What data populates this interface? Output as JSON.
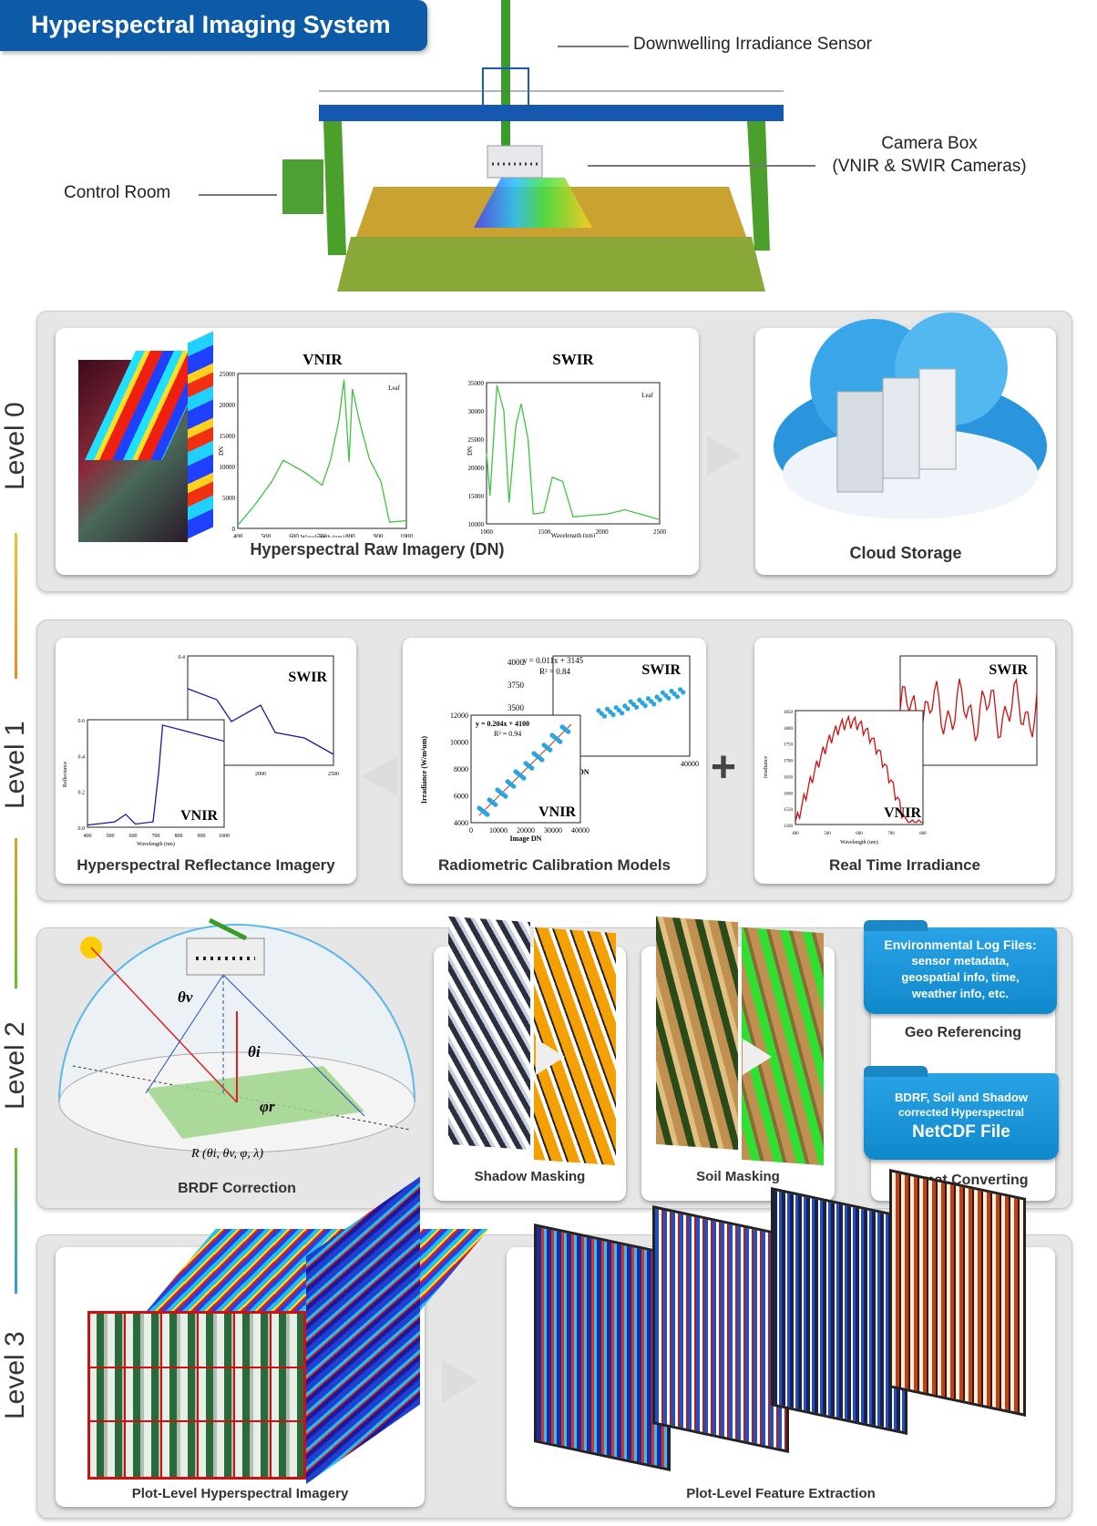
{
  "header": {
    "title": "Hyperspectral Imaging System"
  },
  "system": {
    "sensor_label": "Downwelling Irradiance Sensor",
    "camera_label_1": "Camera Box",
    "camera_label_2": "(VNIR & SWIR Cameras)",
    "control_label": "Control Room"
  },
  "levels": [
    "Level 0",
    "Level 1",
    "Level 2",
    "Level 3"
  ],
  "level0": {
    "raw_caption": "Hyperspectral Raw Imagery (DN)",
    "cloud_caption": "Cloud Storage",
    "vnir": {
      "title": "VNIR",
      "legend": "Leaf",
      "ylabel": "DN",
      "xlabel": "Wavelength (nm)",
      "xticks": [
        "400",
        "500",
        "600",
        "700",
        "800",
        "900",
        "1000"
      ],
      "yticks": [
        "0",
        "5000",
        "10000",
        "15000",
        "20000",
        "25000"
      ]
    },
    "swir": {
      "title": "SWIR",
      "legend": "Leaf",
      "ylabel": "DN",
      "xlabel": "Wavelength (nm)",
      "xticks": [
        "1000",
        "1500",
        "2000",
        "2500"
      ],
      "yticks": [
        "10000",
        "15000",
        "20000",
        "25000",
        "30000",
        "35000"
      ]
    }
  },
  "level1": {
    "refl_caption": "Hyperspectral Reflectance Imagery",
    "cal_caption": "Radiometric Calibration Models",
    "irr_caption": "Real Time Irradiance",
    "refl": {
      "swir_tag": "SWIR",
      "vnir_tag": "VNIR",
      "ylabel": "Reflectance",
      "xlabel": "Wavelength (nm)",
      "vnir_x": [
        "400",
        "500",
        "600",
        "700",
        "800",
        "900",
        "1000"
      ],
      "vnir_y": [
        "0.0",
        "0.2",
        "0.4",
        "0.6"
      ],
      "swir_x": [
        "500",
        "2000",
        "2500"
      ],
      "swir_y": [
        "0.3",
        "0.4"
      ]
    },
    "cal": {
      "swir_tag": "SWIR",
      "vnir_tag": "VNIR",
      "swir_eq": "y = 0.011x + 3145",
      "swir_r2": "R² = 0.84",
      "vnir_eq": "y = 0.204x + 4100",
      "vnir_r2": "R² = 0.94",
      "ylabel": "Irradiance (W/m²um)",
      "xlabel": "Image DN",
      "swir_ylabel": "e (W/m²um)",
      "swir_xlabel": "nage DN",
      "vnir_x": [
        "0",
        "10000",
        "20000",
        "30000",
        "40000"
      ],
      "vnir_y": [
        "4000",
        "6000",
        "8000",
        "10000",
        "12000"
      ],
      "swir_x": [
        "000",
        "40000"
      ],
      "swir_y": [
        "3500",
        "3750",
        "4000"
      ]
    },
    "irr": {
      "swir_tag": "SWIR",
      "vnir_tag": "VNIR",
      "ylabel": "Irradiance",
      "xlabel": "Wavelength (nm)",
      "vnir_x": [
        "400",
        "500",
        "600",
        "700",
        "800"
      ],
      "vnir_y": [
        "1500",
        "1550",
        "1600",
        "1650",
        "1700",
        "1750",
        "1800",
        "1850"
      ],
      "swir_y": [
        "3500"
      ],
      "plus": "+"
    }
  },
  "level2": {
    "brdf_caption": "BRDF Correction",
    "theta_v": "θv",
    "theta_i": "θi",
    "phi_r": "φr",
    "formula": "R (θi, θv, φ, λ)",
    "shadow_caption": "Shadow Masking",
    "soil_caption": "Soil Masking",
    "env_folder": {
      "title": "Environmental Log Files:",
      "lines": [
        "sensor metadata,",
        "geospatial info, time,",
        "weather info, etc."
      ]
    },
    "geo_caption": "Geo Referencing",
    "netcdf_folder": {
      "line1": "BDRF, Soil and Shadow",
      "line2": "corrected Hyperspectral",
      "line3": "NetCDF File"
    },
    "format_caption": "Format Converting"
  },
  "level3": {
    "plot_caption": "Plot-Level Hyperspectral Imagery",
    "feature_caption": "Plot-Level Feature Extraction"
  },
  "colors": {
    "banner": "#0d5aa7",
    "spectrum_green": "#3fc43f",
    "refl_blue": "#1a1aa0",
    "irr_red": "#d01010",
    "scatter_blue": "#2aa6df",
    "folder_blue": "#1a95d8",
    "arrow_orange": "#f0a020",
    "arrow_green": "#6cc02a",
    "arrow_blue": "#2a9fe0"
  }
}
